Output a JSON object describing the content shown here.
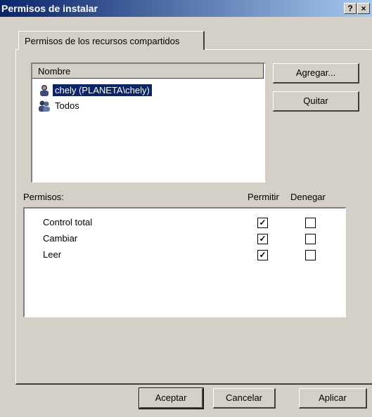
{
  "window": {
    "title": "Permisos de instalar",
    "help_btn": "?",
    "close_btn": "×"
  },
  "tab": {
    "label": "Permisos de los recursos compartidos"
  },
  "users": {
    "column_header": "Nombre",
    "items": [
      {
        "label": "chely (PLANETA\\chely)",
        "icon": "user-icon",
        "selected": true
      },
      {
        "label": "Todos",
        "icon": "group-icon",
        "selected": false
      }
    ]
  },
  "buttons": {
    "add": "Agregar...",
    "remove": "Quitar",
    "ok": "Aceptar",
    "cancel": "Cancelar",
    "apply": "Aplicar"
  },
  "permissions": {
    "label": "Permisos:",
    "allow_header": "Permitir",
    "deny_header": "Denegar",
    "rows": [
      {
        "name": "Control total",
        "allow": true,
        "deny": false
      },
      {
        "name": "Cambiar",
        "allow": true,
        "deny": false
      },
      {
        "name": "Leer",
        "allow": true,
        "deny": false
      }
    ]
  },
  "colors": {
    "title_start": "#0a246a",
    "title_end": "#a6caf0",
    "selection": "#0a246a",
    "face": "#d4d0c8"
  }
}
